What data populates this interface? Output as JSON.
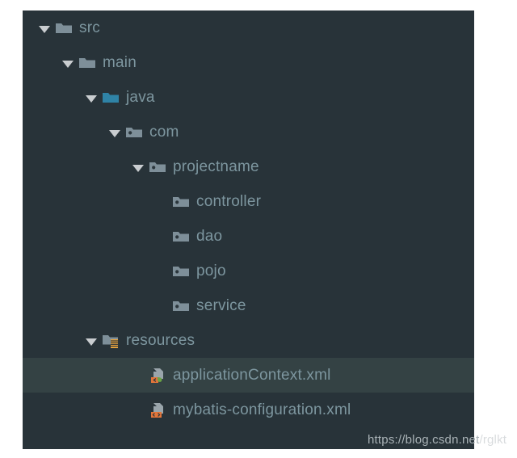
{
  "panel": {
    "background_color": "#283339",
    "selected_row_color": "#344244",
    "label_color": "#7d969f",
    "arrow_color": "#c9cdd0"
  },
  "tree": {
    "items": [
      {
        "label": "src",
        "depth": 0,
        "expandable": true,
        "expanded": true,
        "icon": "folder-icon",
        "icon_color": "#7e8f99",
        "selected": false
      },
      {
        "label": "main",
        "depth": 1,
        "expandable": true,
        "expanded": true,
        "icon": "folder-icon",
        "icon_color": "#7e8f99",
        "selected": false
      },
      {
        "label": "java",
        "depth": 2,
        "expandable": true,
        "expanded": true,
        "icon": "folder-source-root-icon",
        "icon_color": "#2f83a6",
        "selected": false
      },
      {
        "label": "com",
        "depth": 3,
        "expandable": true,
        "expanded": true,
        "icon": "package-icon",
        "icon_color": "#7e8f99",
        "selected": false
      },
      {
        "label": "projectname",
        "depth": 4,
        "expandable": true,
        "expanded": true,
        "icon": "package-icon",
        "icon_color": "#7e8f99",
        "selected": false
      },
      {
        "label": "controller",
        "depth": 5,
        "expandable": false,
        "expanded": false,
        "icon": "package-icon",
        "icon_color": "#7e8f99",
        "selected": false
      },
      {
        "label": "dao",
        "depth": 5,
        "expandable": false,
        "expanded": false,
        "icon": "package-icon",
        "icon_color": "#7e8f99",
        "selected": false
      },
      {
        "label": "pojo",
        "depth": 5,
        "expandable": false,
        "expanded": false,
        "icon": "package-icon",
        "icon_color": "#7e8f99",
        "selected": false
      },
      {
        "label": "service",
        "depth": 5,
        "expandable": false,
        "expanded": false,
        "icon": "package-icon",
        "icon_color": "#7e8f99",
        "selected": false
      },
      {
        "label": "resources",
        "depth": 2,
        "expandable": true,
        "expanded": true,
        "icon": "folder-resources-icon",
        "icon_color": "#7e8f99",
        "badge_color": "#e8a33d",
        "selected": false
      },
      {
        "label": "applicationContext.xml",
        "depth": 4,
        "expandable": false,
        "expanded": false,
        "icon": "spring-xml-file-icon",
        "icon_color": "#9aa5ab",
        "badge_color": "#e2753a",
        "leaf_color": "#6aa344",
        "selected": true
      },
      {
        "label": "mybatis-configuration.xml",
        "depth": 4,
        "expandable": false,
        "expanded": false,
        "icon": "xml-file-icon",
        "icon_color": "#9aa5ab",
        "badge_color": "#e2753a",
        "selected": false
      }
    ]
  },
  "watermark": {
    "text_inside": "https://blog.csdn.net",
    "text_outside": "/rglkt"
  }
}
